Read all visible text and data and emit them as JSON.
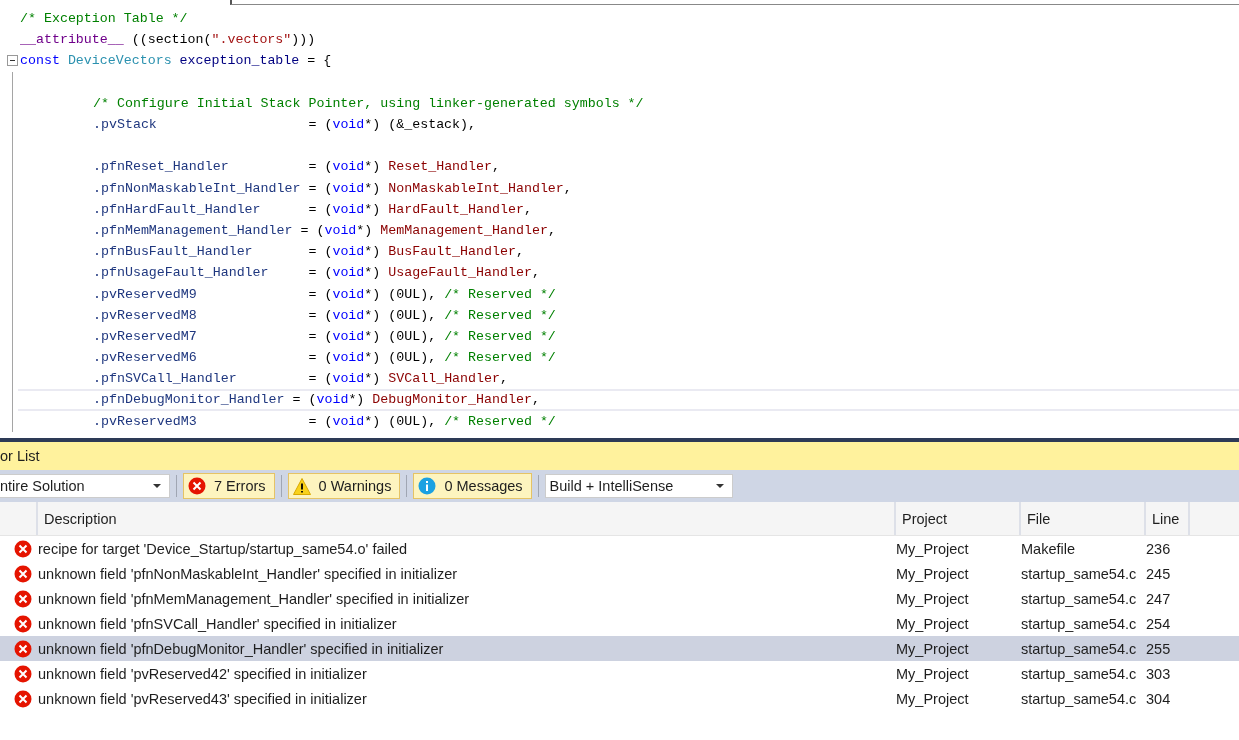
{
  "editor": {
    "lines": [
      {
        "fold": false,
        "tokens": [
          {
            "kind": "comment",
            "text": "/* Exception Table */"
          }
        ]
      },
      {
        "fold": false,
        "tokens": [
          {
            "kind": "macro",
            "text": "__attribute__"
          },
          {
            "kind": "plain",
            "text": " ((section("
          },
          {
            "kind": "string",
            "text": "\".vectors\""
          },
          {
            "kind": "plain",
            "text": ")))"
          }
        ]
      },
      {
        "fold": true,
        "tokens": [
          {
            "kind": "keyword",
            "text": "const "
          },
          {
            "kind": "type",
            "text": "DeviceVectors "
          },
          {
            "kind": "variable",
            "text": "exception_table"
          },
          {
            "kind": "plain",
            "text": " = {"
          }
        ],
        "children": [
          {
            "blank_before": true,
            "current": false,
            "tokens": [
              {
                "kind": "comment",
                "text": "/* Configure Initial Stack Pointer, using linker-generated symbols */"
              }
            ]
          },
          {
            "current": false,
            "tokens": [
              {
                "kind": "member",
                "text": ".pvStack                   "
              },
              {
                "kind": "plain",
                "text": "= ("
              },
              {
                "kind": "keyword",
                "text": "void"
              },
              {
                "kind": "plain",
                "text": "*) (&_estack),"
              }
            ]
          },
          {
            "blank_before": true,
            "current": false,
            "tokens": [
              {
                "kind": "member",
                "text": ".pfnReset_Handler          "
              },
              {
                "kind": "plain",
                "text": "= ("
              },
              {
                "kind": "keyword",
                "text": "void"
              },
              {
                "kind": "plain",
                "text": "*) "
              },
              {
                "kind": "function",
                "text": "Reset_Handler"
              },
              {
                "kind": "plain",
                "text": ","
              }
            ]
          },
          {
            "current": false,
            "tokens": [
              {
                "kind": "member",
                "text": ".pfnNonMaskableInt_Handler "
              },
              {
                "kind": "plain",
                "text": "= ("
              },
              {
                "kind": "keyword",
                "text": "void"
              },
              {
                "kind": "plain",
                "text": "*) "
              },
              {
                "kind": "function",
                "text": "NonMaskableInt_Handler"
              },
              {
                "kind": "plain",
                "text": ","
              }
            ]
          },
          {
            "current": false,
            "tokens": [
              {
                "kind": "member",
                "text": ".pfnHardFault_Handler      "
              },
              {
                "kind": "plain",
                "text": "= ("
              },
              {
                "kind": "keyword",
                "text": "void"
              },
              {
                "kind": "plain",
                "text": "*) "
              },
              {
                "kind": "function",
                "text": "HardFault_Handler"
              },
              {
                "kind": "plain",
                "text": ","
              }
            ]
          },
          {
            "current": false,
            "tokens": [
              {
                "kind": "member",
                "text": ".pfnMemManagement_Handler "
              },
              {
                "kind": "plain",
                "text": "= ("
              },
              {
                "kind": "keyword",
                "text": "void"
              },
              {
                "kind": "plain",
                "text": "*) "
              },
              {
                "kind": "function",
                "text": "MemManagement_Handler"
              },
              {
                "kind": "plain",
                "text": ","
              }
            ]
          },
          {
            "current": false,
            "tokens": [
              {
                "kind": "member",
                "text": ".pfnBusFault_Handler       "
              },
              {
                "kind": "plain",
                "text": "= ("
              },
              {
                "kind": "keyword",
                "text": "void"
              },
              {
                "kind": "plain",
                "text": "*) "
              },
              {
                "kind": "function",
                "text": "BusFault_Handler"
              },
              {
                "kind": "plain",
                "text": ","
              }
            ]
          },
          {
            "current": false,
            "tokens": [
              {
                "kind": "member",
                "text": ".pfnUsageFault_Handler     "
              },
              {
                "kind": "plain",
                "text": "= ("
              },
              {
                "kind": "keyword",
                "text": "void"
              },
              {
                "kind": "plain",
                "text": "*) "
              },
              {
                "kind": "function",
                "text": "UsageFault_Handler"
              },
              {
                "kind": "plain",
                "text": ","
              }
            ]
          },
          {
            "current": false,
            "tokens": [
              {
                "kind": "member",
                "text": ".pvReservedM9              "
              },
              {
                "kind": "plain",
                "text": "= ("
              },
              {
                "kind": "keyword",
                "text": "void"
              },
              {
                "kind": "plain",
                "text": "*) (0UL), "
              },
              {
                "kind": "comment",
                "text": "/* Reserved */"
              }
            ]
          },
          {
            "current": false,
            "tokens": [
              {
                "kind": "member",
                "text": ".pvReservedM8              "
              },
              {
                "kind": "plain",
                "text": "= ("
              },
              {
                "kind": "keyword",
                "text": "void"
              },
              {
                "kind": "plain",
                "text": "*) (0UL), "
              },
              {
                "kind": "comment",
                "text": "/* Reserved */"
              }
            ]
          },
          {
            "current": false,
            "tokens": [
              {
                "kind": "member",
                "text": ".pvReservedM7              "
              },
              {
                "kind": "plain",
                "text": "= ("
              },
              {
                "kind": "keyword",
                "text": "void"
              },
              {
                "kind": "plain",
                "text": "*) (0UL), "
              },
              {
                "kind": "comment",
                "text": "/* Reserved */"
              }
            ]
          },
          {
            "current": false,
            "tokens": [
              {
                "kind": "member",
                "text": ".pvReservedM6              "
              },
              {
                "kind": "plain",
                "text": "= ("
              },
              {
                "kind": "keyword",
                "text": "void"
              },
              {
                "kind": "plain",
                "text": "*) (0UL), "
              },
              {
                "kind": "comment",
                "text": "/* Reserved */"
              }
            ]
          },
          {
            "current": false,
            "tokens": [
              {
                "kind": "member",
                "text": ".pfnSVCall_Handler         "
              },
              {
                "kind": "plain",
                "text": "= ("
              },
              {
                "kind": "keyword",
                "text": "void"
              },
              {
                "kind": "plain",
                "text": "*) "
              },
              {
                "kind": "function",
                "text": "SVCall_Handler"
              },
              {
                "kind": "plain",
                "text": ","
              }
            ]
          },
          {
            "current": true,
            "tokens": [
              {
                "kind": "member",
                "text": ".pfnDebugMonitor_Handler "
              },
              {
                "kind": "plain",
                "text": "= ("
              },
              {
                "kind": "keyword",
                "text": "void"
              },
              {
                "kind": "plain",
                "text": "*) "
              },
              {
                "kind": "function",
                "text": "DebugMonitor_Handler"
              },
              {
                "kind": "plain",
                "text": ","
              }
            ]
          },
          {
            "current": false,
            "tokens": [
              {
                "kind": "member",
                "text": ".pvReservedM3              "
              },
              {
                "kind": "plain",
                "text": "= ("
              },
              {
                "kind": "keyword",
                "text": "void"
              },
              {
                "kind": "plain",
                "text": "*) (0UL), "
              },
              {
                "kind": "comment",
                "text": "/* Reserved */"
              }
            ]
          }
        ]
      }
    ]
  },
  "error_list": {
    "title": "or List",
    "scope": "ntire Solution",
    "filters": [
      {
        "kind": "error",
        "label": "7 Errors",
        "selected": true
      },
      {
        "kind": "warning",
        "label": "0 Warnings",
        "selected": true
      },
      {
        "kind": "message",
        "label": "0 Messages",
        "selected": true
      }
    ],
    "source": "Build + IntelliSense",
    "columns": [
      "Description",
      "Project",
      "File",
      "Line"
    ],
    "rows": [
      {
        "description": "recipe for target 'Device_Startup/startup_same54.o' failed",
        "project": "My_Project",
        "file": "Makefile",
        "line": "236",
        "selected": false
      },
      {
        "description": "unknown field 'pfnNonMaskableInt_Handler' specified in initializer",
        "project": "My_Project",
        "file": "startup_same54.c",
        "line": "245",
        "selected": false
      },
      {
        "description": "unknown field 'pfnMemManagement_Handler' specified in initializer",
        "project": "My_Project",
        "file": "startup_same54.c",
        "line": "247",
        "selected": false
      },
      {
        "description": "unknown field 'pfnSVCall_Handler' specified in initializer",
        "project": "My_Project",
        "file": "startup_same54.c",
        "line": "254",
        "selected": false
      },
      {
        "description": "unknown field 'pfnDebugMonitor_Handler' specified in initializer",
        "project": "My_Project",
        "file": "startup_same54.c",
        "line": "255",
        "selected": true
      },
      {
        "description": "unknown field 'pvReserved42' specified in initializer",
        "project": "My_Project",
        "file": "startup_same54.c",
        "line": "303",
        "selected": false
      },
      {
        "description": "unknown field 'pvReserved43' specified in initializer",
        "project": "My_Project",
        "file": "startup_same54.c",
        "line": "304",
        "selected": false
      }
    ]
  }
}
